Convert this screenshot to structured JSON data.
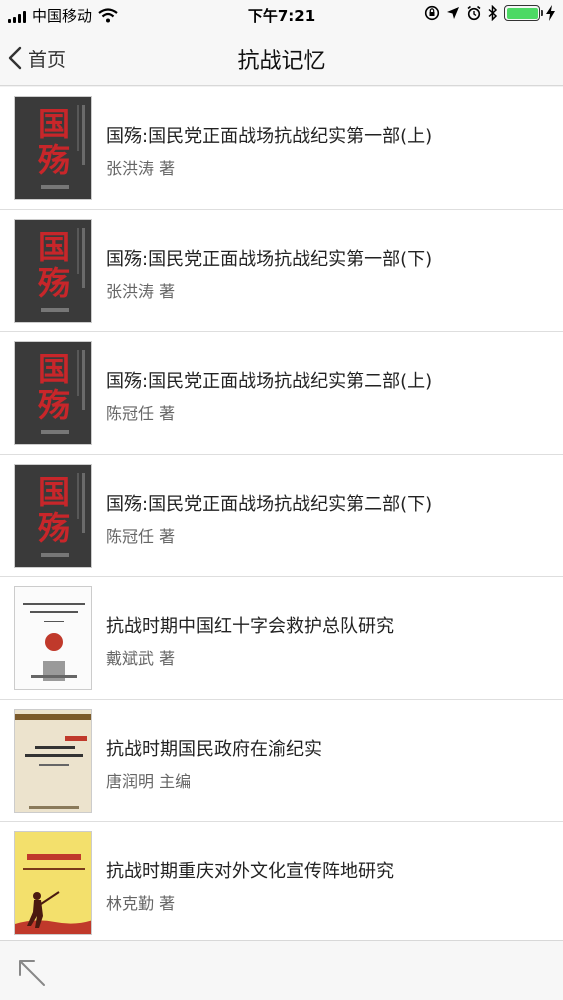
{
  "status_bar": {
    "carrier": "中国移动",
    "time": "下午7:21"
  },
  "nav": {
    "back_label": "首页",
    "title": "抗战记忆"
  },
  "books": [
    {
      "title": "国殇:国民党正面战场抗战纪实第一部(上)",
      "author": "张洪涛 著"
    },
    {
      "title": "国殇:国民党正面战场抗战纪实第一部(下)",
      "author": "张洪涛 著"
    },
    {
      "title": "国殇:国民党正面战场抗战纪实第二部(上)",
      "author": "陈冠任 著"
    },
    {
      "title": "国殇:国民党正面战场抗战纪实第二部(下)",
      "author": "陈冠任 著"
    },
    {
      "title": "抗战时期中国红十字会救护总队研究",
      "author": "戴斌武 著"
    },
    {
      "title": "抗战时期国民政府在渝纪实",
      "author": "唐润明 主编"
    },
    {
      "title": "抗战时期重庆对外文化宣传阵地研究",
      "author": "林克勤 著"
    }
  ],
  "covers": {
    "guoshang_glyph_1": "国",
    "guoshang_glyph_2": "殇"
  },
  "colors": {
    "battery": "#4cd964",
    "cover_red": "#c8262a",
    "cover_yellow": "#f3e06c"
  },
  "icons": {
    "back": "chevron-left-icon",
    "scroll_top": "arrow-up-left-icon"
  }
}
